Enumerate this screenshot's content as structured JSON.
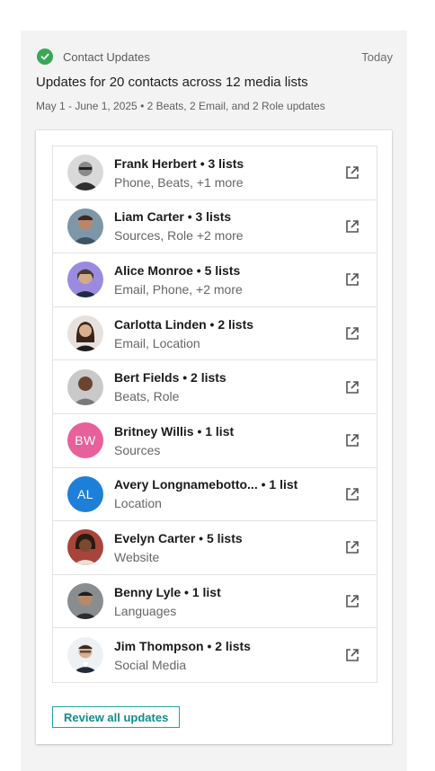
{
  "header": {
    "label": "Contact Updates",
    "date": "Today",
    "summary": "Updates for 20 contacts across 12 media lists",
    "subsummary": "May 1 - June 1, 2025 • 2 Beats, 2 Email, and 2 Role updates"
  },
  "contacts": [
    {
      "name_line": "Frank Herbert • 3 lists",
      "detail": "Phone, Beats, +1 more"
    },
    {
      "name_line": "Liam Carter • 3 lists",
      "detail": "Sources, Role +2 more"
    },
    {
      "name_line": "Alice Monroe • 5 lists",
      "detail": "Email, Phone, +2 more"
    },
    {
      "name_line": "Carlotta Linden • 2 lists",
      "detail": "Email, Location"
    },
    {
      "name_line": "Bert Fields • 2 lists",
      "detail": "Beats, Role"
    },
    {
      "name_line": "Britney Willis • 1 list",
      "detail": "Sources",
      "initials": "BW",
      "avatar_color": "#e8609a"
    },
    {
      "name_line": "Avery Longnamebotto... • 1 list",
      "detail": "Location",
      "initials": "AL",
      "avatar_color": "#1e7fd8"
    },
    {
      "name_line": "Evelyn Carter • 5 lists",
      "detail": "Website"
    },
    {
      "name_line": "Benny Lyle • 1 list",
      "detail": "Languages"
    },
    {
      "name_line": "Jim Thompson • 2 lists",
      "detail": "Social Media"
    }
  ],
  "actions": {
    "review_label": "Review all updates"
  },
  "colors": {
    "success": "#3aa757",
    "accent": "#1ba5a5"
  },
  "icons": {
    "status": "check-circle-icon",
    "row_action": "external-link-icon"
  }
}
